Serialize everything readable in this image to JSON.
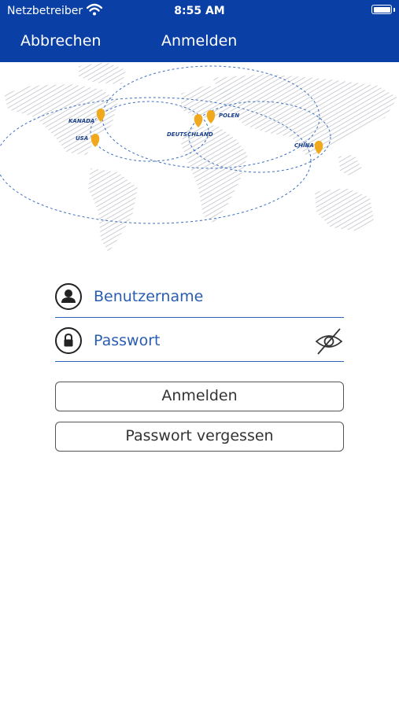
{
  "status_bar": {
    "carrier": "Netzbetreiber",
    "time": "8:55 AM"
  },
  "nav": {
    "cancel_label": "Abbrechen",
    "title": "Anmelden"
  },
  "map": {
    "labels": {
      "kanada": "KANADA",
      "usa": "USA",
      "deutschland": "DEUTSCHLAND",
      "polen": "POLEN",
      "china": "CHINA"
    },
    "pin_color": "#f0a81c",
    "route_color": "#3f6fc0"
  },
  "form": {
    "username_placeholder": "Benutzername",
    "password_placeholder": "Passwort",
    "login_button": "Anmelden",
    "forgot_button": "Passwort vergessen"
  },
  "colors": {
    "brand": "#0a40a6",
    "accent": "#2a5db0"
  }
}
